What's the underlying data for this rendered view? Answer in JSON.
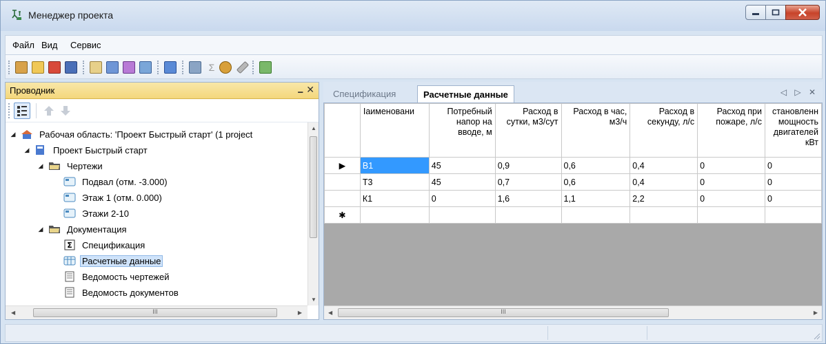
{
  "window": {
    "title": "Менеджер проекта"
  },
  "menu": {
    "items": [
      "Файл",
      "Вид",
      "Сервис"
    ]
  },
  "toolbar": {
    "icons": [
      "new-icon",
      "open-icon",
      "close-file-icon",
      "save-icon",
      "properties-icon",
      "edit-icon",
      "print-icon",
      "preview-icon",
      "settings-icon",
      "calculator-icon",
      "sum-icon",
      "users-icon",
      "tools-icon",
      "export-icon"
    ]
  },
  "explorer": {
    "title": "Проводник",
    "pin_label": "ᛘ",
    "close_label": "✕",
    "tree": [
      {
        "level": 0,
        "expanded": true,
        "icon": "workspace-icon",
        "label": "Рабочая область: 'Проект Быстрый старт' (1 project"
      },
      {
        "level": 1,
        "expanded": true,
        "icon": "project-icon",
        "label": "Проект Быстрый старт"
      },
      {
        "level": 2,
        "expanded": true,
        "icon": "folder-icon",
        "label": "Чертежи"
      },
      {
        "level": 3,
        "expanded": null,
        "icon": "drawing-icon",
        "label": "Подвал (отм. -3.000)"
      },
      {
        "level": 3,
        "expanded": null,
        "icon": "drawing-icon",
        "label": "Этаж 1 (отм. 0.000)"
      },
      {
        "level": 3,
        "expanded": null,
        "icon": "drawing-icon",
        "label": "Этажи 2-10"
      },
      {
        "level": 2,
        "expanded": true,
        "icon": "folder-icon",
        "label": "Документация"
      },
      {
        "level": 3,
        "expanded": null,
        "icon": "sigma-icon",
        "label": "Спецификация"
      },
      {
        "level": 3,
        "expanded": null,
        "icon": "table-icon",
        "label": "Расчетные данные",
        "selected": true
      },
      {
        "level": 3,
        "expanded": null,
        "icon": "document-icon",
        "label": "Ведомость чертежей"
      },
      {
        "level": 3,
        "expanded": null,
        "icon": "document-icon",
        "label": "Ведомость документов"
      }
    ],
    "scroll_arrow_h": "III"
  },
  "tabs": [
    {
      "label": "Спецификация",
      "active": false
    },
    {
      "label": "Расчетные данные",
      "active": true
    }
  ],
  "tab_nav": "◁ ▷ ✕",
  "grid": {
    "columns": [
      "Iаименовани",
      "Потребный напор на вводе, м",
      "Расход в сутки, м3/сут",
      "Расход в час, м3/ч",
      "Расход в секунду, л/с",
      "Расход при пожаре, л/с",
      "становленн мощность двигателей кВт"
    ],
    "rows": [
      {
        "marker": "▶",
        "cells": [
          "В1",
          "45",
          "0,9",
          "0,6",
          "0,4",
          "0",
          "0"
        ]
      },
      {
        "marker": "",
        "cells": [
          "Т3",
          "45",
          "0,7",
          "0,6",
          "0,4",
          "0",
          "0"
        ]
      },
      {
        "marker": "",
        "cells": [
          "К1",
          "0",
          "1,6",
          "1,1",
          "2,2",
          "0",
          "0"
        ]
      },
      {
        "marker": "✱",
        "cells": [
          "",
          "",
          "",
          "",
          "",
          "",
          ""
        ]
      }
    ],
    "scroll_label": "III"
  }
}
